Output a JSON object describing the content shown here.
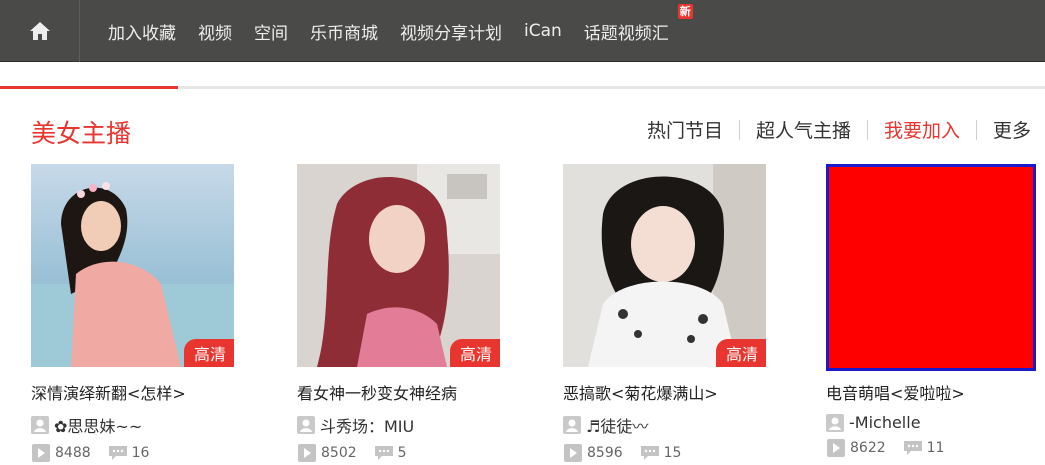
{
  "nav": {
    "home_icon": "home-icon",
    "items": [
      {
        "label": "加入收藏"
      },
      {
        "label": "视频"
      },
      {
        "label": "空间"
      },
      {
        "label": "乐币商城"
      },
      {
        "label": "视频分享计划"
      },
      {
        "label": "iCan"
      },
      {
        "label": "话题视频汇"
      }
    ],
    "new_badge": "新"
  },
  "scroll_progress": 0.17,
  "section": {
    "title": "美女主播",
    "links": [
      {
        "label": "热门节目"
      },
      {
        "label": "超人气主播"
      },
      {
        "label": "我要加入"
      },
      {
        "label": "更多"
      }
    ]
  },
  "cards": [
    {
      "title": "深情演绎新翻<怎样>",
      "user": "✿思思妹~~",
      "plays": "8488",
      "comments": "16",
      "badge": "高清"
    },
    {
      "title": "看女神一秒变女神经病",
      "user": "斗秀场：MIU",
      "plays": "8502",
      "comments": "5",
      "badge": "高清"
    },
    {
      "title": "恶搞歌<菊花爆满山>",
      "user": "♬徒徒〰",
      "plays": "8596",
      "comments": "15",
      "badge": "高清"
    },
    {
      "title": "电音萌唱<爱啦啦>",
      "user": "-Michelle",
      "plays": "8622",
      "comments": "11"
    }
  ],
  "colors": {
    "accent": "#e8352f",
    "nav_bg": "#4a4a48",
    "placeholder": "#ff0000",
    "placeholder_border": "#1a1acc"
  }
}
